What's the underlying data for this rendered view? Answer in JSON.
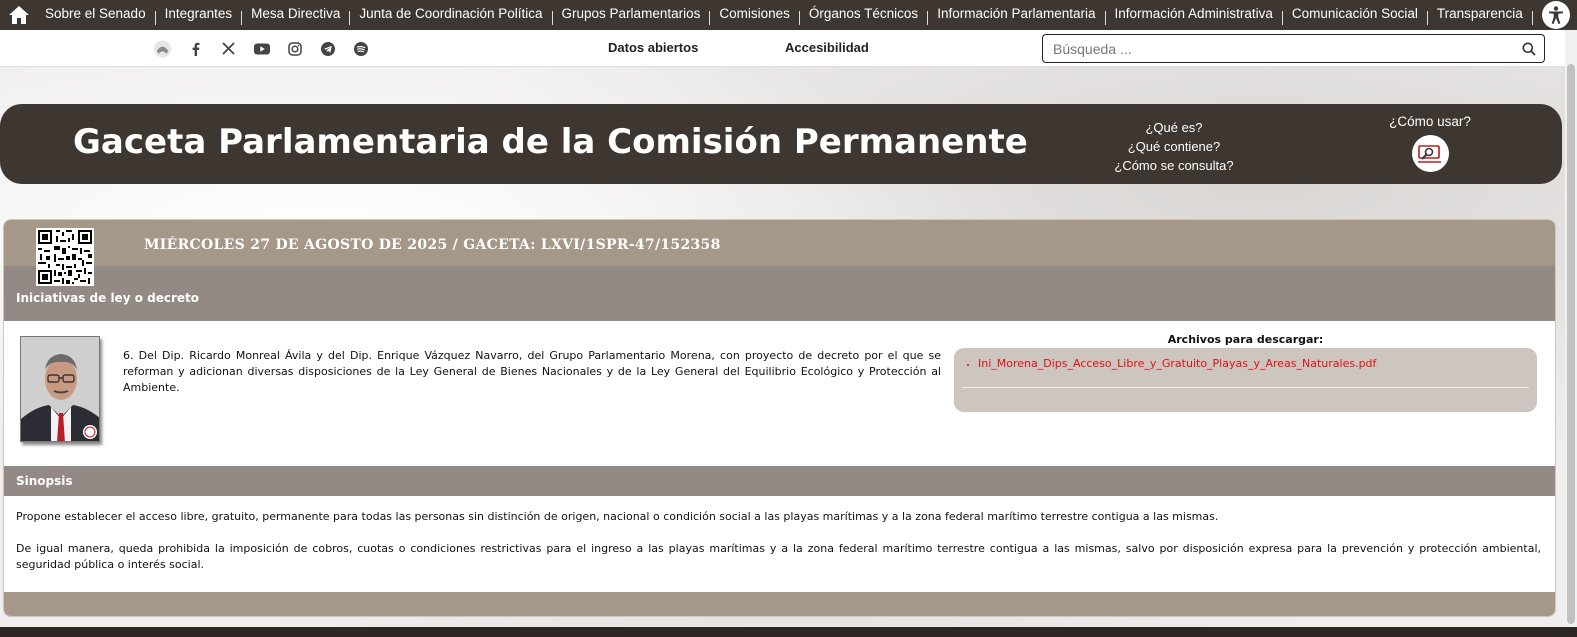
{
  "topnav": {
    "home_icon": "home-icon",
    "items": [
      "Sobre el Senado",
      "Integrantes",
      "Mesa Directiva",
      "Junta de Coordinación Política",
      "Grupos Parlamentarios",
      "Comisiones",
      "Órganos Técnicos",
      "Información Parlamentaria",
      "Información Administrativa",
      "Comunicación Social",
      "Transparencia"
    ],
    "accessibility_icon": "accessibility-icon"
  },
  "subbar": {
    "social_icons": [
      "senate-logo-icon",
      "facebook-icon",
      "x-icon",
      "youtube-icon",
      "instagram-icon",
      "telegram-icon",
      "spotify-icon"
    ],
    "datos_abiertos": "Datos abiertos",
    "accesibilidad": "Accesibilidad",
    "search_placeholder": "Búsqueda ..."
  },
  "banner": {
    "title": "Gaceta Parlamentaria de la Comisión Permanente",
    "links": [
      "¿Qué es?",
      "¿Qué contiene?",
      "¿Cómo se consulta?"
    ],
    "como_usar": "¿Cómo usar?"
  },
  "gaceta": {
    "date_line": "MIÉRCOLES 27 DE AGOSTO DE 2025 / GACETA: LXVI/1SPR-47/152358",
    "section_title": "Iniciativas de ley o decreto",
    "initiative_text": "6. Del Dip. Ricardo Monreal Ávila y del Dip. Enrique Vázquez Navarro, del Grupo Parlamentario Morena, con proyecto de decreto por el que se reforman y adicionan diversas disposiciones de la Ley General de Bienes Nacionales y de la Ley General del Equilibrio Ecológico y Protección al Ambiente.",
    "files_title": "Archivos para descargar:",
    "files": [
      "Ini_Morena_Dips_Acceso_Libre_y_Gratuito_Playas_y_Areas_Naturales.pdf"
    ],
    "synopsis_title": "Sinopsis",
    "synopsis_p1": "Propone establecer el acceso libre, gratuito, permanente para todas las personas sin distinción de origen, nacional o condición social a las playas marítimas y a la zona federal marítimo terrestre contigua a las mismas.",
    "synopsis_p2": "De igual manera, queda prohibida la imposición de cobros, cuotas o condiciones restrictivas para el ingreso a las playas marítimas y a la zona federal marítimo terrestre contigua a las mismas, salvo por disposición expresa para la prevención y protección ambiental, seguridad pública o interés social."
  },
  "colors": {
    "nav_bg": "#3e3630",
    "card_header": "#a59889",
    "section_header": "#948a85",
    "file_box": "#cdc6c0",
    "link_red": "#e01010"
  }
}
